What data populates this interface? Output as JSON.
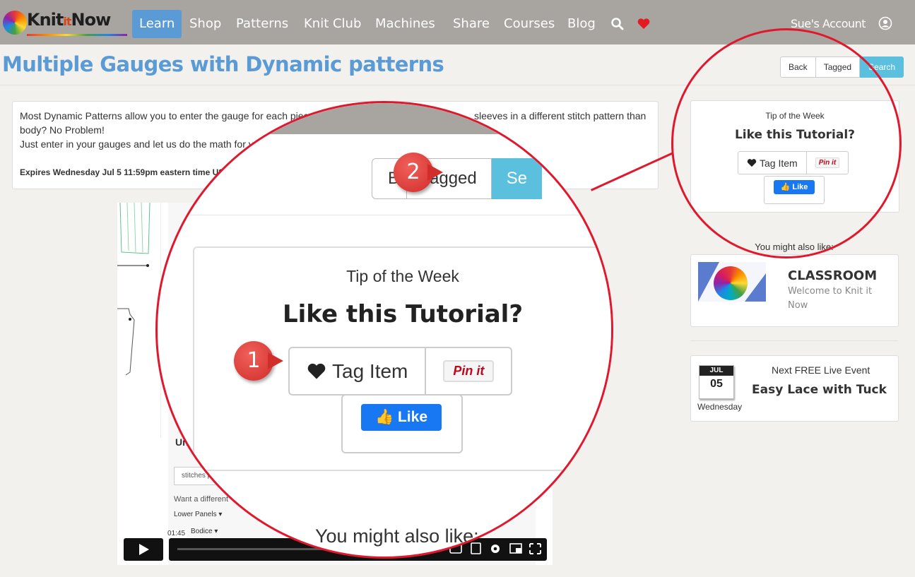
{
  "nav": {
    "logo_text": "Knit it Now",
    "logo_main": "Knit",
    "logo_it": "it",
    "logo_now": "Now",
    "items": [
      "Learn",
      "Shop",
      "Patterns",
      "Knit Club",
      "Machines",
      "Share",
      "Courses",
      "Blog"
    ],
    "active_item": "Learn",
    "account": "Sue's Account",
    "heart_color": "#e31b23"
  },
  "page": {
    "title": "Multiple Gauges with Dynamic patterns",
    "buttons": [
      "Back",
      "Tagged",
      "Search"
    ]
  },
  "article": {
    "line1": "Most Dynamic Patterns allow you to enter the gauge for each piece",
    "line1_end": "sleeves in a different stitch pattern than the",
    "line2": "body? No Problem!",
    "line3": "Just enter in your gauges and let us do the math for y",
    "expires": "Expires Wednesday Jul 5 11:59pm eastern time US"
  },
  "video": {
    "timecode": "01:45",
    "field_label": "Univ",
    "placeholder": "stitches p",
    "want": "Want a different",
    "lower_panels": "Lower Panels ▾",
    "bodice": "Bodice ▾"
  },
  "tip": {
    "label": "Tip of the Week",
    "heading": "Like this Tutorial?",
    "tag_button": "Tag Item",
    "pin_button": "Pin it",
    "like_button": "Like"
  },
  "sidebar": {
    "also_like": "You might also like:",
    "classroom_title": "CLASSROOM",
    "classroom_sub": "Welcome to Knit it Now",
    "event_label": "Next FREE Live Event",
    "event_title": "Easy Lace with Tuck",
    "cal_month": "JUL",
    "cal_day": "05",
    "cal_dow": "Wednesday"
  },
  "zoom": {
    "buttons": [
      "B",
      "Tagged",
      "Se"
    ],
    "also_like": "You might also like:",
    "badge1": "1",
    "badge2": "2",
    "annotation_color": "#e0182d"
  }
}
